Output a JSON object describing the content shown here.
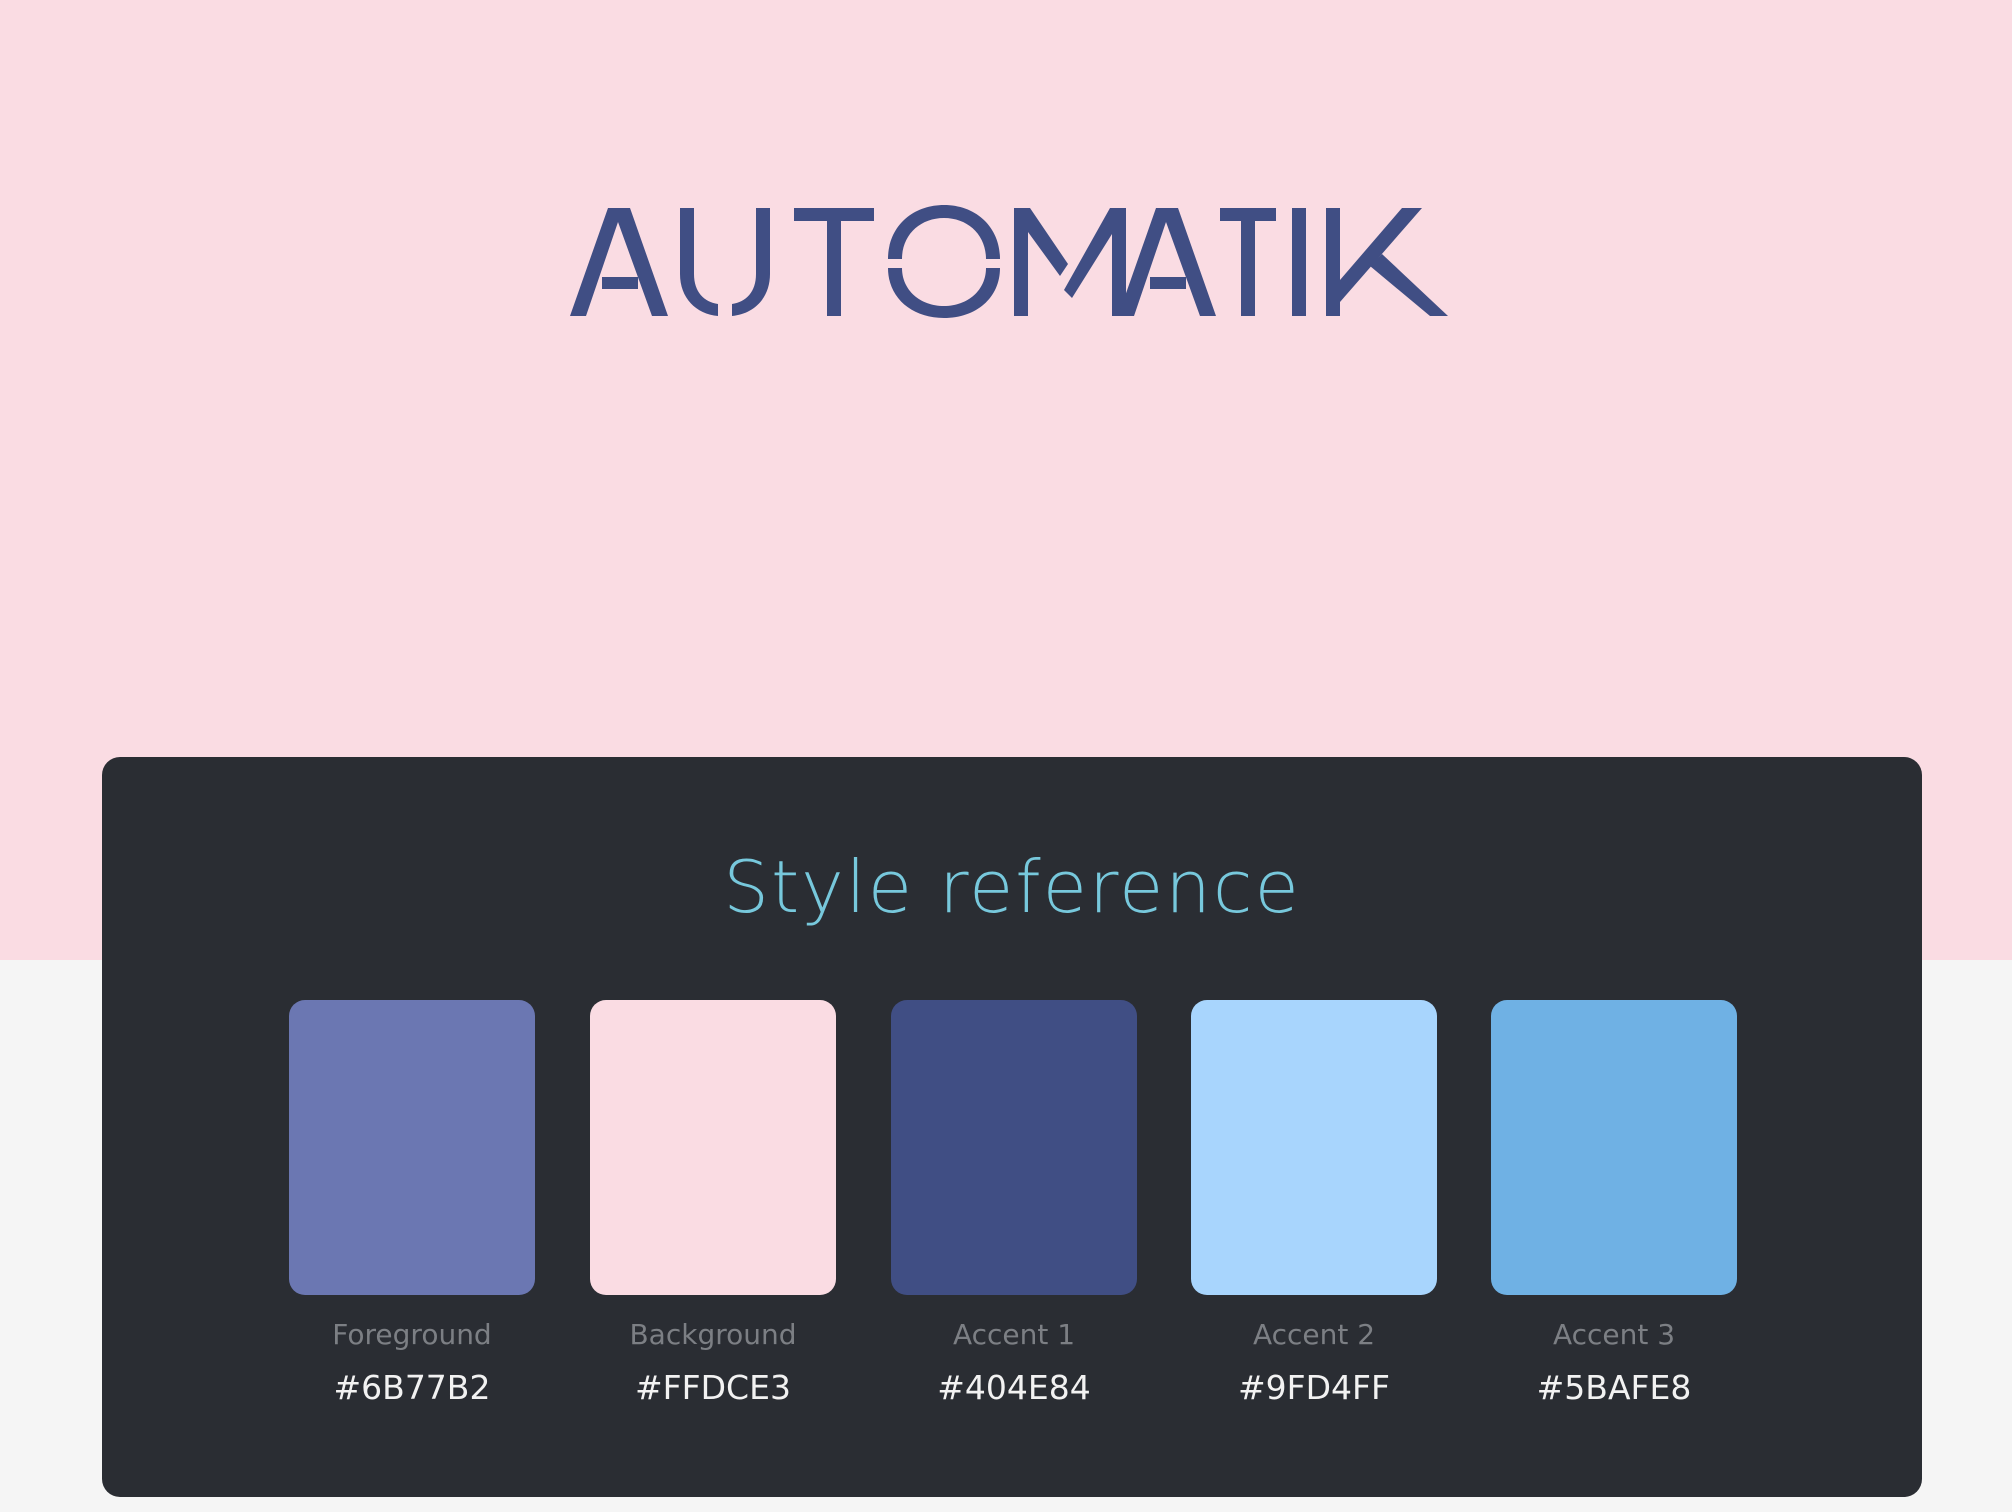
{
  "hero": {
    "logo_text": "AUTOMATIK",
    "background": "#FADCE3",
    "logo_color": "#404E84"
  },
  "style_reference": {
    "title": "Style reference",
    "panel_color": "#2A2D33",
    "swatches": [
      {
        "name": "Foreground",
        "hex": "#6B77B2",
        "color": "#6B77B2"
      },
      {
        "name": "Background",
        "hex": "#FFDCE3",
        "color": "#FADCE3"
      },
      {
        "name": "Accent 1",
        "hex": "#404E84",
        "color": "#404E84"
      },
      {
        "name": "Accent 2",
        "hex": "#9FD4FF",
        "color": "#A8D5FD"
      },
      {
        "name": "Accent 3",
        "hex": "#5BAFE8",
        "color": "#6FB1E4"
      }
    ]
  }
}
